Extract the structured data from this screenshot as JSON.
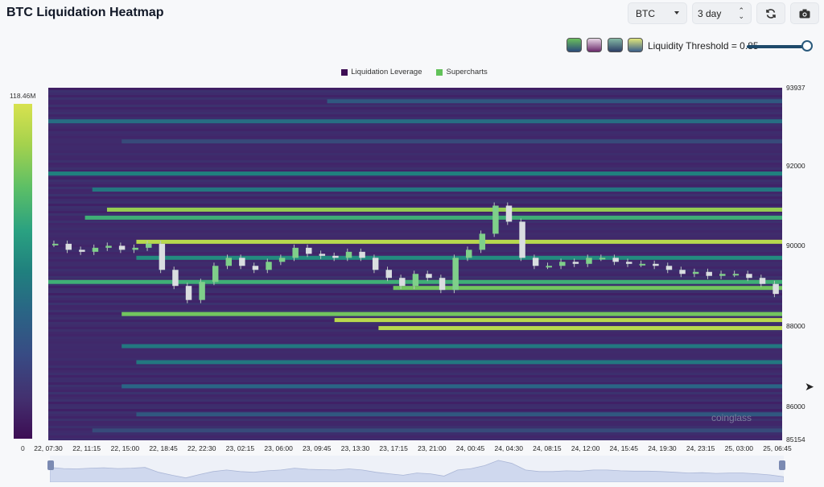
{
  "header": {
    "title": "BTC Liquidation Heatmap",
    "symbol_value": "BTC",
    "range_value": "3 day",
    "refresh_icon": "refresh-icon",
    "camera_icon": "camera-icon"
  },
  "controls": {
    "threshold_label": "Liquidity Threshold = 0.85",
    "threshold_value": 0.85,
    "palettes": [
      {
        "name": "palette-viridis",
        "top": "#6abf5c",
        "bottom": "#2b4a7a"
      },
      {
        "name": "palette-magma",
        "top": "#e7d7e6",
        "bottom": "#6b2a6b"
      },
      {
        "name": "palette-teal",
        "top": "#84b8a4",
        "bottom": "#2d3f66"
      },
      {
        "name": "palette-yellow",
        "top": "#e0e67a",
        "bottom": "#3a5f8a"
      }
    ]
  },
  "legend": {
    "items": [
      {
        "label": "Liquidation Leverage",
        "color": "#3d0d54"
      },
      {
        "label": "Supercharts",
        "color": "#62c25a"
      }
    ]
  },
  "colorbar": {
    "max_label": "118.46M",
    "min_label": "0"
  },
  "chart_data": {
    "type": "heatmap",
    "title": "BTC Liquidation Heatmap",
    "y_ticks": [
      "93937",
      "92000",
      "90000",
      "88000",
      "86000",
      "85154"
    ],
    "y_range": [
      85154,
      93937
    ],
    "x_ticks": [
      "22, 07:30",
      "22, 11:15",
      "22, 15:00",
      "22, 18:45",
      "22, 22:30",
      "23, 02:15",
      "23, 06:00",
      "23, 09:45",
      "23, 13:30",
      "23, 17:15",
      "23, 21:00",
      "24, 00:45",
      "24, 04:30",
      "24, 08:15",
      "24, 12:00",
      "24, 15:45",
      "24, 19:30",
      "24, 23:15",
      "25, 03:00",
      "25, 06:45"
    ],
    "price_series_approx": [
      90050,
      89900,
      89850,
      89950,
      90000,
      89900,
      89950,
      90050,
      89400,
      89000,
      88650,
      89100,
      89500,
      89700,
      89500,
      89400,
      89600,
      89700,
      89950,
      89800,
      89750,
      89700,
      89850,
      89700,
      89400,
      89200,
      89000,
      89300,
      89200,
      88900,
      89700,
      89900,
      90300,
      91000,
      90600,
      89700,
      89500,
      89500,
      89600,
      89550,
      89700,
      89700,
      89600,
      89550,
      89550,
      89500,
      89400,
      89300,
      89350,
      89250,
      89300,
      89300,
      89200,
      89050,
      88800
    ],
    "bands": [
      {
        "price": 93600,
        "intensity": 0.35,
        "start": 0.38
      },
      {
        "price": 93100,
        "intensity": 0.45,
        "start": 0.0
      },
      {
        "price": 92600,
        "intensity": 0.3,
        "start": 0.1
      },
      {
        "price": 91800,
        "intensity": 0.55,
        "start": 0.0
      },
      {
        "price": 91400,
        "intensity": 0.5,
        "start": 0.06
      },
      {
        "price": 90900,
        "intensity": 0.9,
        "start": 0.08
      },
      {
        "price": 90700,
        "intensity": 0.75,
        "start": 0.05
      },
      {
        "price": 90100,
        "intensity": 0.95,
        "start": 0.12
      },
      {
        "price": 89700,
        "intensity": 0.6,
        "start": 0.12
      },
      {
        "price": 89100,
        "intensity": 0.75,
        "start": 0.0
      },
      {
        "price": 88950,
        "intensity": 0.85,
        "start": 0.47
      },
      {
        "price": 88300,
        "intensity": 0.85,
        "start": 0.1
      },
      {
        "price": 88150,
        "intensity": 0.95,
        "start": 0.39
      },
      {
        "price": 87950,
        "intensity": 0.95,
        "start": 0.45
      },
      {
        "price": 87500,
        "intensity": 0.5,
        "start": 0.1
      },
      {
        "price": 87100,
        "intensity": 0.5,
        "start": 0.12
      },
      {
        "price": 86500,
        "intensity": 0.4,
        "start": 0.1
      },
      {
        "price": 85800,
        "intensity": 0.35,
        "start": 0.12
      },
      {
        "price": 85400,
        "intensity": 0.3,
        "start": 0.06
      }
    ]
  },
  "watermark": "coinglass"
}
